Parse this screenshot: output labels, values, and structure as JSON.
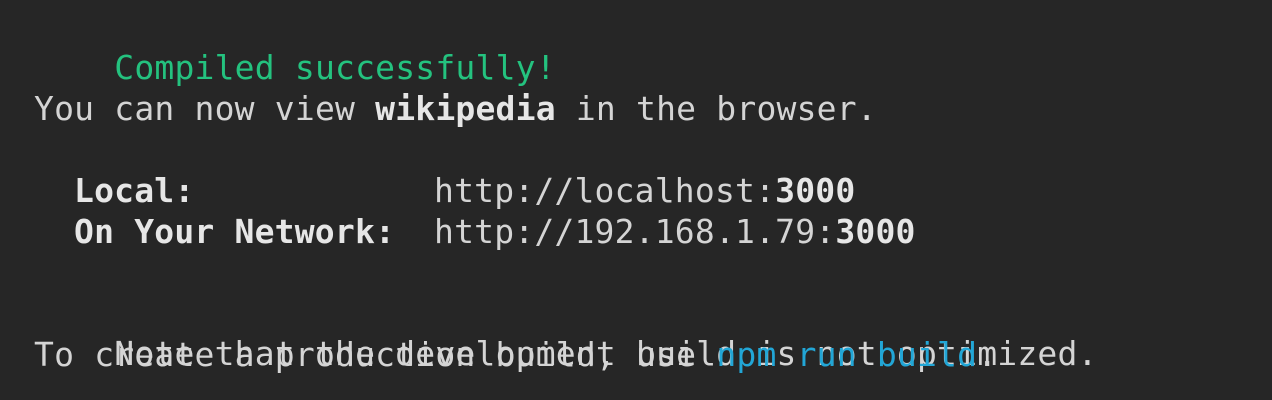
{
  "terminal": {
    "status": "Compiled successfully!",
    "view_prefix": "You can now view ",
    "app_name": "wikipedia",
    "view_suffix": " in the browser.",
    "local_label": "Local:",
    "local_url_base": "http://localhost:",
    "local_port": "3000",
    "network_label": "On Your Network:",
    "network_url_base": "http://192.168.1.79:",
    "network_port": "3000",
    "note_line": "Note that the development build is not optimized.",
    "prod_prefix": "To create a production build, use ",
    "build_command": "npm run build",
    "prod_suffix": "."
  },
  "colors": {
    "background": "#262626",
    "text": "#d4d4d4",
    "success": "#24c27f",
    "command": "#22a6d6"
  }
}
